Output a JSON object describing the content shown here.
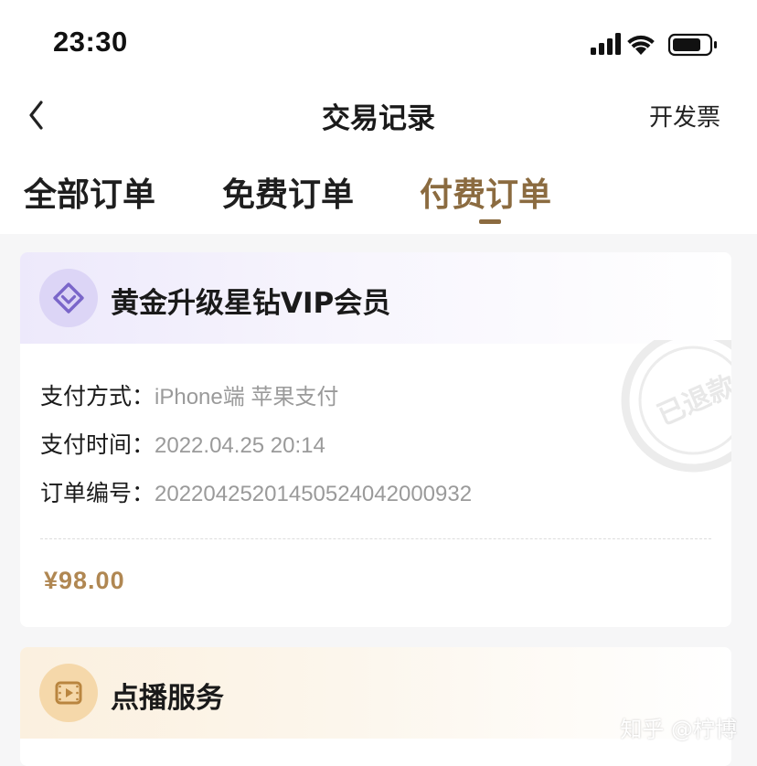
{
  "status_bar": {
    "time": "23:30"
  },
  "nav": {
    "title": "交易记录",
    "action_label": "开发票"
  },
  "tabs": [
    {
      "label": "全部订单",
      "active": false
    },
    {
      "label": "免费订单",
      "active": false
    },
    {
      "label": "付费订单",
      "active": true
    }
  ],
  "orders": [
    {
      "title": "黄金升级星钻VIP会员",
      "icon": "diamond-heart-icon",
      "status_stamp": "已退款",
      "rows": [
        {
          "label": "支付方式：",
          "value": "iPhone端 苹果支付"
        },
        {
          "label": "支付时间：",
          "value": "2022.04.25 20:14"
        },
        {
          "label": "订单编号：",
          "value": "20220425201450524042000932"
        }
      ],
      "price": "¥98.00"
    },
    {
      "title": "点播服务",
      "icon": "video-play-icon"
    }
  ],
  "watermark": "知乎 @柠博",
  "colors": {
    "accent": "#8b6b40",
    "price": "#b08752",
    "vip_badge": "#dcd5f6",
    "vod_badge": "#f5d8aa",
    "muted_text": "#9a9a9a"
  }
}
